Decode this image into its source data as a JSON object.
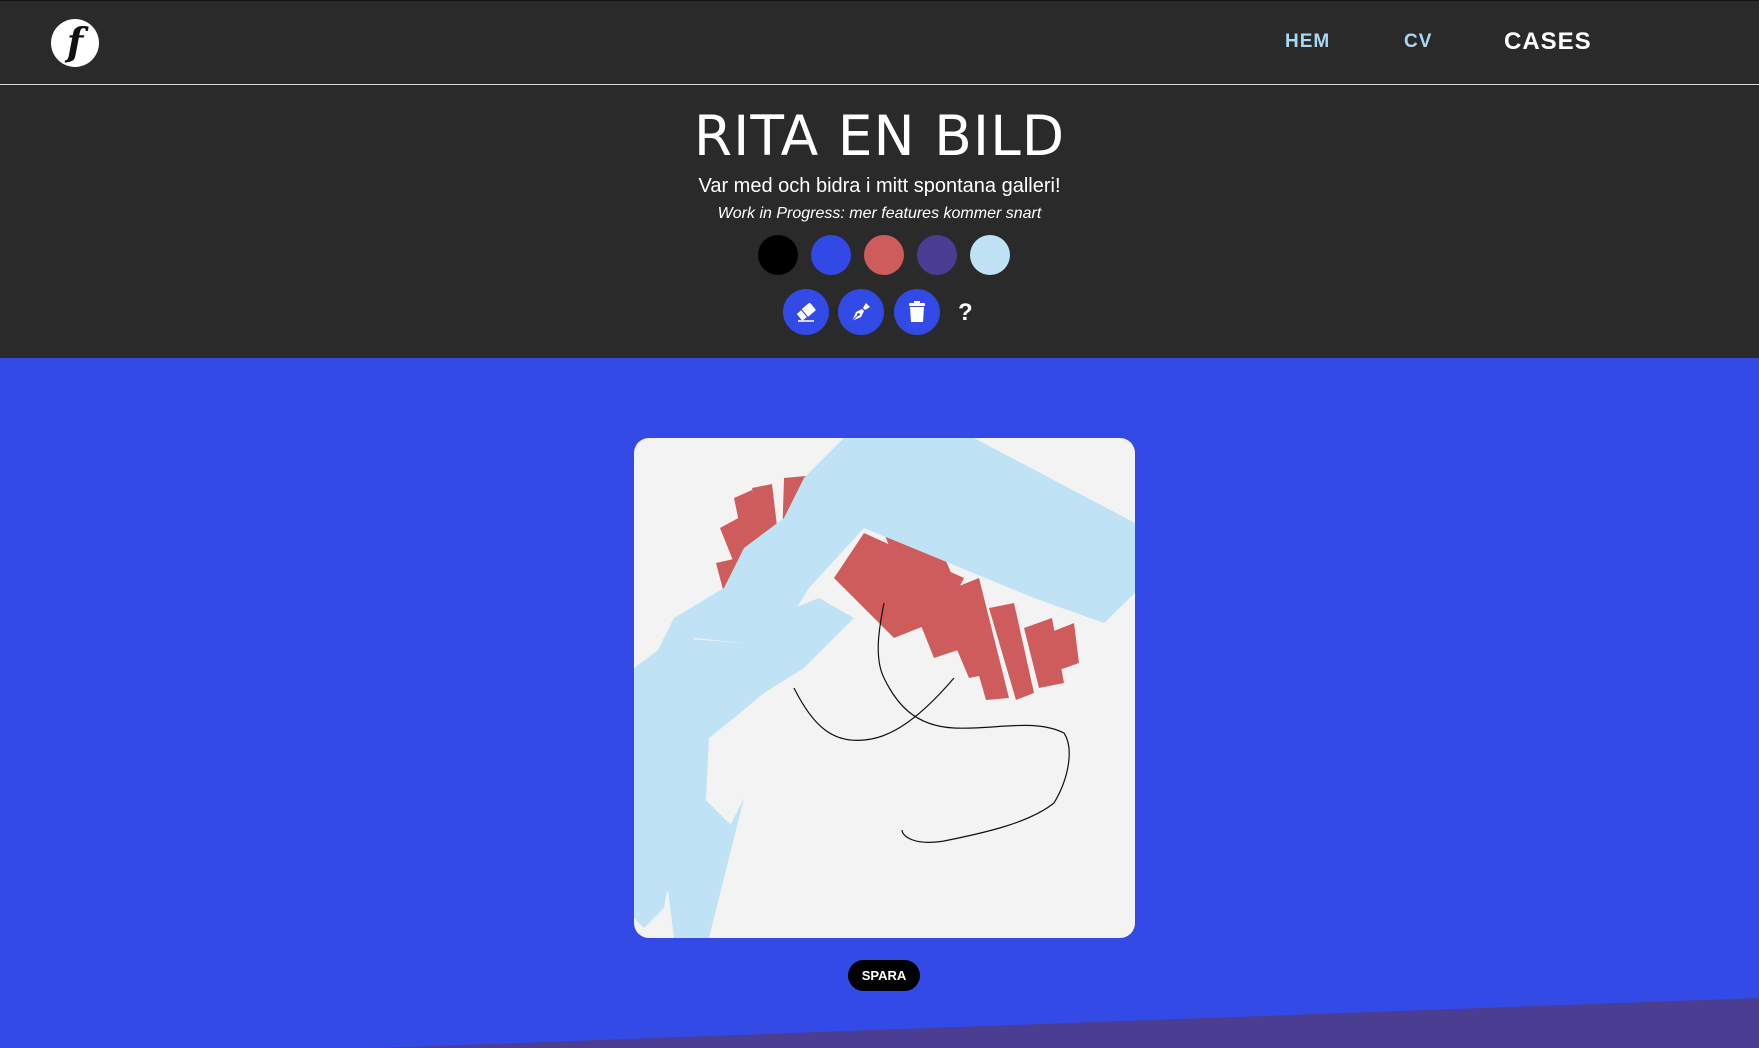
{
  "header": {
    "logo_letter": "f",
    "nav": [
      {
        "label": "HEM"
      },
      {
        "label": "CV"
      },
      {
        "label": "CASES"
      }
    ]
  },
  "hero": {
    "title": "RITA EN BILD",
    "subtitle": "Var med och bidra i mitt spontana galleri!",
    "note": "Work in Progress: mer features kommer snart"
  },
  "palette": {
    "colors": [
      "#000000",
      "#3249e6",
      "#cf5c5c",
      "#4b3d92",
      "#bfe3f4"
    ]
  },
  "tools": {
    "eraser_icon": "eraser-icon",
    "pen_icon": "pen-nib-icon",
    "trash_icon": "trash-icon",
    "help_label": "?"
  },
  "colors": {
    "header_bg": "#2a2a2a",
    "stage_bg": "#334ae6",
    "wedge": "#4a3d92",
    "canvas_bg": "#f3f3f3",
    "button_blue": "#324be6"
  },
  "actions": {
    "save_label": "SPARA"
  }
}
